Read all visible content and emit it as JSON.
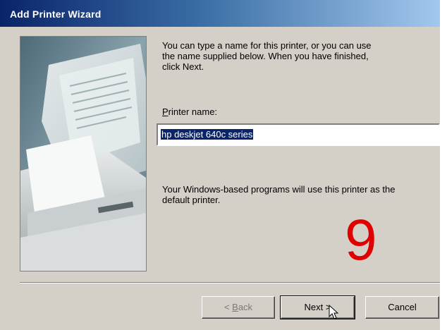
{
  "window": {
    "title": "Add Printer Wizard"
  },
  "content": {
    "intro_line1": "You can type a name for this printer, or you can use",
    "intro_line2": "the name supplied below. When you have finished,",
    "intro_line3": "click Next.",
    "printer_name_label_accel": "P",
    "printer_name_label_rest": "rinter name:",
    "printer_name_value": "hp deskjet 640c series",
    "default_line1": "Your Windows-based programs will use this printer as the",
    "default_line2": "default printer."
  },
  "overlay": {
    "step_number": "9"
  },
  "buttons": {
    "back_prefix": "< ",
    "back_accel": "B",
    "back_rest": "ack",
    "next_label": "Next >",
    "cancel_label": "Cancel"
  },
  "icons": {
    "wizard_image": "printer-image",
    "cursor": "mouse-pointer-icon"
  },
  "colors": {
    "title_bar": "#0a246a",
    "selection": "#0a246a",
    "marker": "#e00000"
  }
}
